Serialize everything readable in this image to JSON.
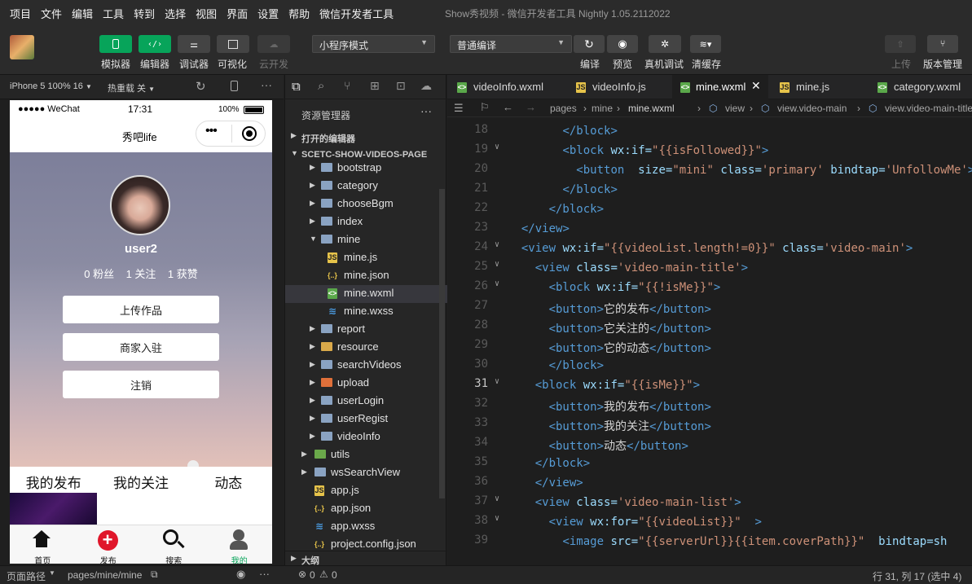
{
  "menubar": {
    "items": [
      "项目",
      "文件",
      "编辑",
      "工具",
      "转到",
      "选择",
      "视图",
      "界面",
      "设置",
      "帮助",
      "微信开发者工具"
    ],
    "window_title": "Show秀视频 - 微信开发者工具 Nightly 1.05.2112022"
  },
  "toolbar": {
    "simulator": "模拟器",
    "editor": "编辑器",
    "debugger": "调试器",
    "visual": "可视化",
    "cloud": "云开发",
    "mode_select": "小程序模式",
    "compile_select": "普通编译",
    "compile": "编译",
    "preview": "预览",
    "real_debug": "真机调试",
    "clear_cache": "清缓存",
    "upload": "上传",
    "version": "版本管理"
  },
  "simbar": {
    "device": "iPhone 5 100% 16",
    "hotreload": "热重载 关"
  },
  "phone": {
    "carrier": "●●●●● WeChat",
    "time": "17:31",
    "battery": "100%",
    "nav_title": "秀吧life",
    "username": "user2",
    "stats": "0 粉丝    1 关注    1 获赞",
    "buttons": [
      "上传作品",
      "商家入驻",
      "注销"
    ],
    "tabs": [
      "我的发布",
      "我的关注",
      "动态"
    ],
    "tabbar": [
      "首页",
      "发布",
      "搜索",
      "我的"
    ]
  },
  "explorer": {
    "title": "资源管理器",
    "open_editors": "打开的编辑器",
    "project": "SCETC-SHOW-VIDEOS-PAGE",
    "items": [
      "bootstrap",
      "category",
      "chooseBgm",
      "index",
      "mine",
      "mine.js",
      "mine.json",
      "mine.wxml",
      "mine.wxss",
      "report",
      "resource",
      "searchVideos",
      "upload",
      "userLogin",
      "userRegist",
      "videoInfo",
      "utils",
      "wsSearchView",
      "app.js",
      "app.json",
      "app.wxss",
      "project.config.json"
    ],
    "outline": "大纲"
  },
  "editor": {
    "tabs": [
      "videoInfo.wxml",
      "videoInfo.js",
      "mine.wxml",
      "mine.js",
      "category.wxml"
    ],
    "crumbs": [
      "pages",
      "mine",
      "mine.wxml",
      "view",
      "view.video-main",
      "view.video-main-title"
    ],
    "status": "行 31, 列 17 (选中 4)"
  },
  "bottom": {
    "path_label": "页面路径",
    "path": "pages/mine/mine",
    "problems": "0",
    "warnings": "0"
  },
  "code": [
    {
      "n": "18",
      "fold": "",
      "src": "        </block>"
    },
    {
      "n": "19",
      "fold": "v",
      "src": "        <block wx:if=\"{{isFollowed}}\">"
    },
    {
      "n": "20",
      "fold": "",
      "src": "          <button  size=\"mini\" class='primary' bindtap='UnfollowMe'>"
    },
    {
      "n": "21",
      "fold": "",
      "src": "        </block>"
    },
    {
      "n": "22",
      "fold": "",
      "src": "      </block>"
    },
    {
      "n": "23",
      "fold": "",
      "src": "  </view>"
    },
    {
      "n": "24",
      "fold": "v",
      "src": "  <view wx:if=\"{{videoList.length!=0}}\" class='video-main'>"
    },
    {
      "n": "25",
      "fold": "v",
      "src": "    <view class='video-main-title'>"
    },
    {
      "n": "26",
      "fold": "v",
      "src": "      <block wx:if=\"{{!isMe}}\">"
    },
    {
      "n": "27",
      "fold": "",
      "src": "      <button>它的发布</button>"
    },
    {
      "n": "28",
      "fold": "",
      "src": "      <button>它关注的</button>"
    },
    {
      "n": "29",
      "fold": "",
      "src": "      <button>它的动态</button>"
    },
    {
      "n": "30",
      "fold": "",
      "src": "      </block>"
    },
    {
      "n": "31",
      "fold": "v",
      "src": "    <block wx:if=\"{{isMe}}\">"
    },
    {
      "n": "32",
      "fold": "",
      "src": "      <button>我的发布</button>"
    },
    {
      "n": "33",
      "fold": "",
      "src": "      <button>我的关注</button>"
    },
    {
      "n": "34",
      "fold": "",
      "src": "      <button>动态</button>"
    },
    {
      "n": "35",
      "fold": "",
      "src": "    </block>"
    },
    {
      "n": "36",
      "fold": "",
      "src": "    </view>"
    },
    {
      "n": "37",
      "fold": "v",
      "src": "    <view class='video-main-list'>"
    },
    {
      "n": "38",
      "fold": "v",
      "src": "      <view wx:for=\"{{videoList}}\"  >"
    },
    {
      "n": "39",
      "fold": "",
      "src": "        <image src=\"{{serverUrl}}{{item.coverPath}}\"  bindtap='sh"
    }
  ]
}
